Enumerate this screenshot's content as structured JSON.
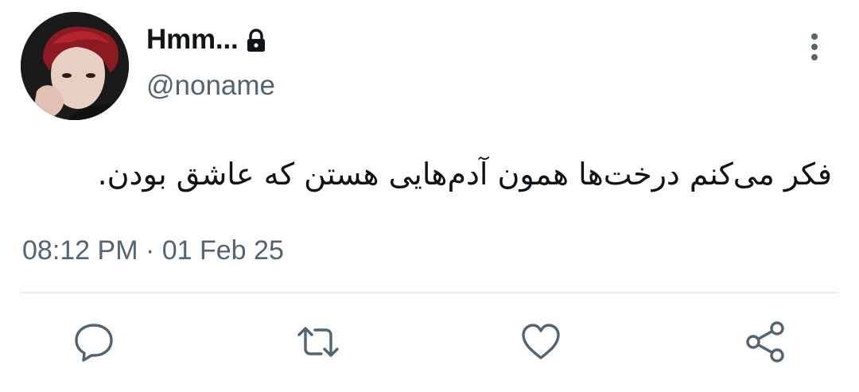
{
  "tweet": {
    "display_name": "Hmm...",
    "handle": "@noname",
    "text": "فکر می‌کنم درخت‌ها همون آدم‌هایی هستن که عاشق بودن.",
    "timestamp": "08:12 PM · 01 Feb 25",
    "protected": true
  },
  "icons": {
    "lock": "lock-icon",
    "more": "vertical-ellipsis-icon",
    "reply": "speech-bubble-icon",
    "retweet": "retweet-arrows-icon",
    "like": "heart-icon",
    "share": "share-nodes-icon"
  },
  "colors": {
    "text_primary": "#0f1419",
    "text_secondary": "#536471",
    "divider": "#e6ecf0",
    "background": "#ffffff"
  }
}
